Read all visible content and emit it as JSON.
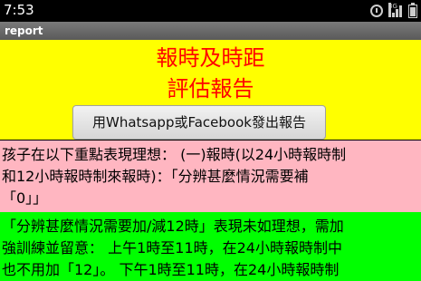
{
  "status_bar": {
    "time": "7:53",
    "network_label": "3G"
  },
  "title_bar": {
    "title": "report"
  },
  "report": {
    "title_line1": "報時及時距",
    "title_line2": "評估報告",
    "share_button_label": "用Whatsapp或Facebook發出報告"
  },
  "sections": {
    "pink_text": "孩子在以下重點表現理想： (一)報時(以24小時報時制\n和12小時報時制來報時)：「分辨甚麼情況需要補\n「0」」",
    "green_text": "「分辨甚麼情況需要加/減12時」表現未如理想，需加\n強訓練並留意： 上午1時至11時，在24小時報時制中\n也不用加「12」。 下午1時至11時，在24小時報時制"
  },
  "colors": {
    "highlight_yellow": "#ffff00",
    "good_pink": "#ffb6c1",
    "improve_green": "#00ff00",
    "title_red": "#ff0000"
  }
}
